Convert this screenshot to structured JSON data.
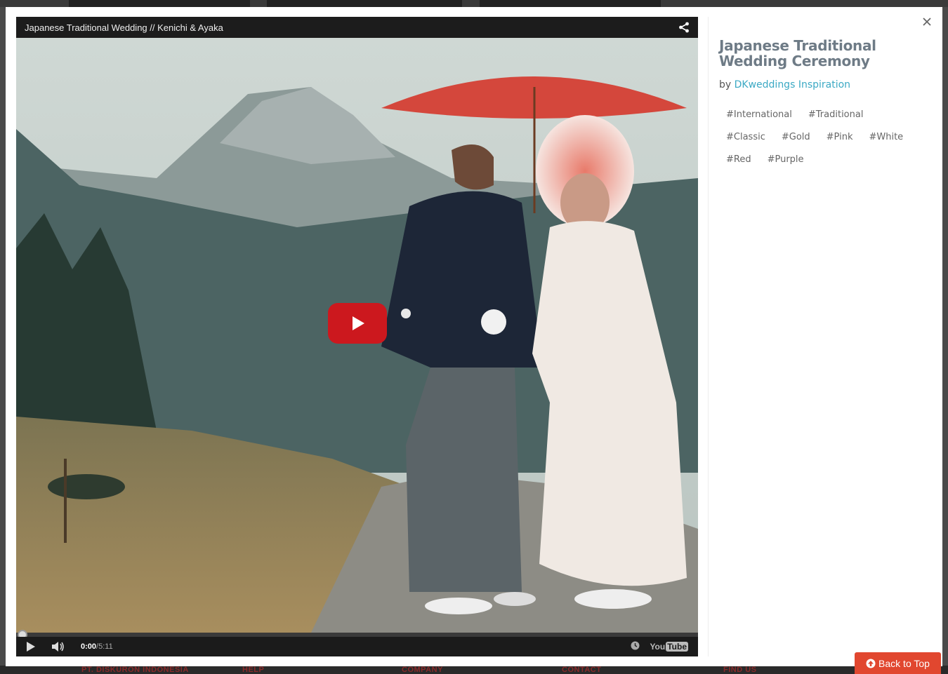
{
  "video": {
    "title": "Japanese Traditional Wedding // Kenichi & Ayaka",
    "progress": 0.0,
    "current_time": "0:00",
    "separator": " / ",
    "duration": "5:11",
    "logo_you": "You",
    "logo_tube": "Tube"
  },
  "sidebar": {
    "title": "Japanese Traditional Wedding Ceremony",
    "by_label": "by ",
    "author": "DKweddings Inspiration",
    "tags": [
      "#International",
      "#Traditional",
      "#Classic",
      "#Gold",
      "#Pink",
      "#White",
      "#Red",
      "#Purple"
    ]
  },
  "footer": {
    "items": [
      "PT. DISKURON INDONESIA",
      "HELP",
      "COMPANY",
      "CONTACT",
      "FIND US"
    ]
  },
  "back_to_top": "Back to Top",
  "colors": {
    "accent_link": "#3ba9c4",
    "play_red": "#cc181e",
    "back_to_top_bg": "#e1472f",
    "title_gray": "#6e7b86"
  },
  "icons": {
    "share": "share-icon",
    "close": "close-icon",
    "play": "play-icon",
    "volume": "volume-icon",
    "clock": "clock-icon",
    "arrow_up": "arrow-up-circle-icon"
  }
}
